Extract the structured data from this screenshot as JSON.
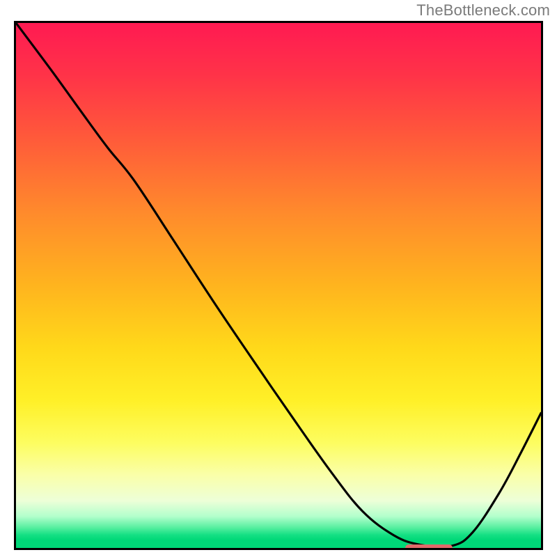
{
  "watermark": "TheBottleneck.com",
  "chart_data": {
    "type": "line",
    "title": "",
    "xlabel": "",
    "ylabel": "",
    "xlim": [
      0,
      1
    ],
    "ylim": [
      0,
      1
    ],
    "gradient_meaning": "background color encodes bottleneck severity: red high → green low",
    "series": [
      {
        "name": "bottleneck-curve",
        "x": [
          0.0,
          0.065,
          0.125,
          0.175,
          0.225,
          0.3,
          0.375,
          0.45,
          0.525,
          0.6,
          0.66,
          0.72,
          0.77,
          0.83,
          0.87,
          0.92,
          0.96,
          1.0
        ],
        "y": [
          1.0,
          0.913,
          0.83,
          0.762,
          0.7,
          0.586,
          0.471,
          0.36,
          0.251,
          0.145,
          0.07,
          0.024,
          0.006,
          0.004,
          0.03,
          0.104,
          0.178,
          0.257
        ]
      }
    ],
    "minimum_marker": {
      "x_start": 0.735,
      "x_end": 0.825,
      "y": 0.008,
      "color": "#e06a6a"
    },
    "curve_color": "#000000"
  }
}
